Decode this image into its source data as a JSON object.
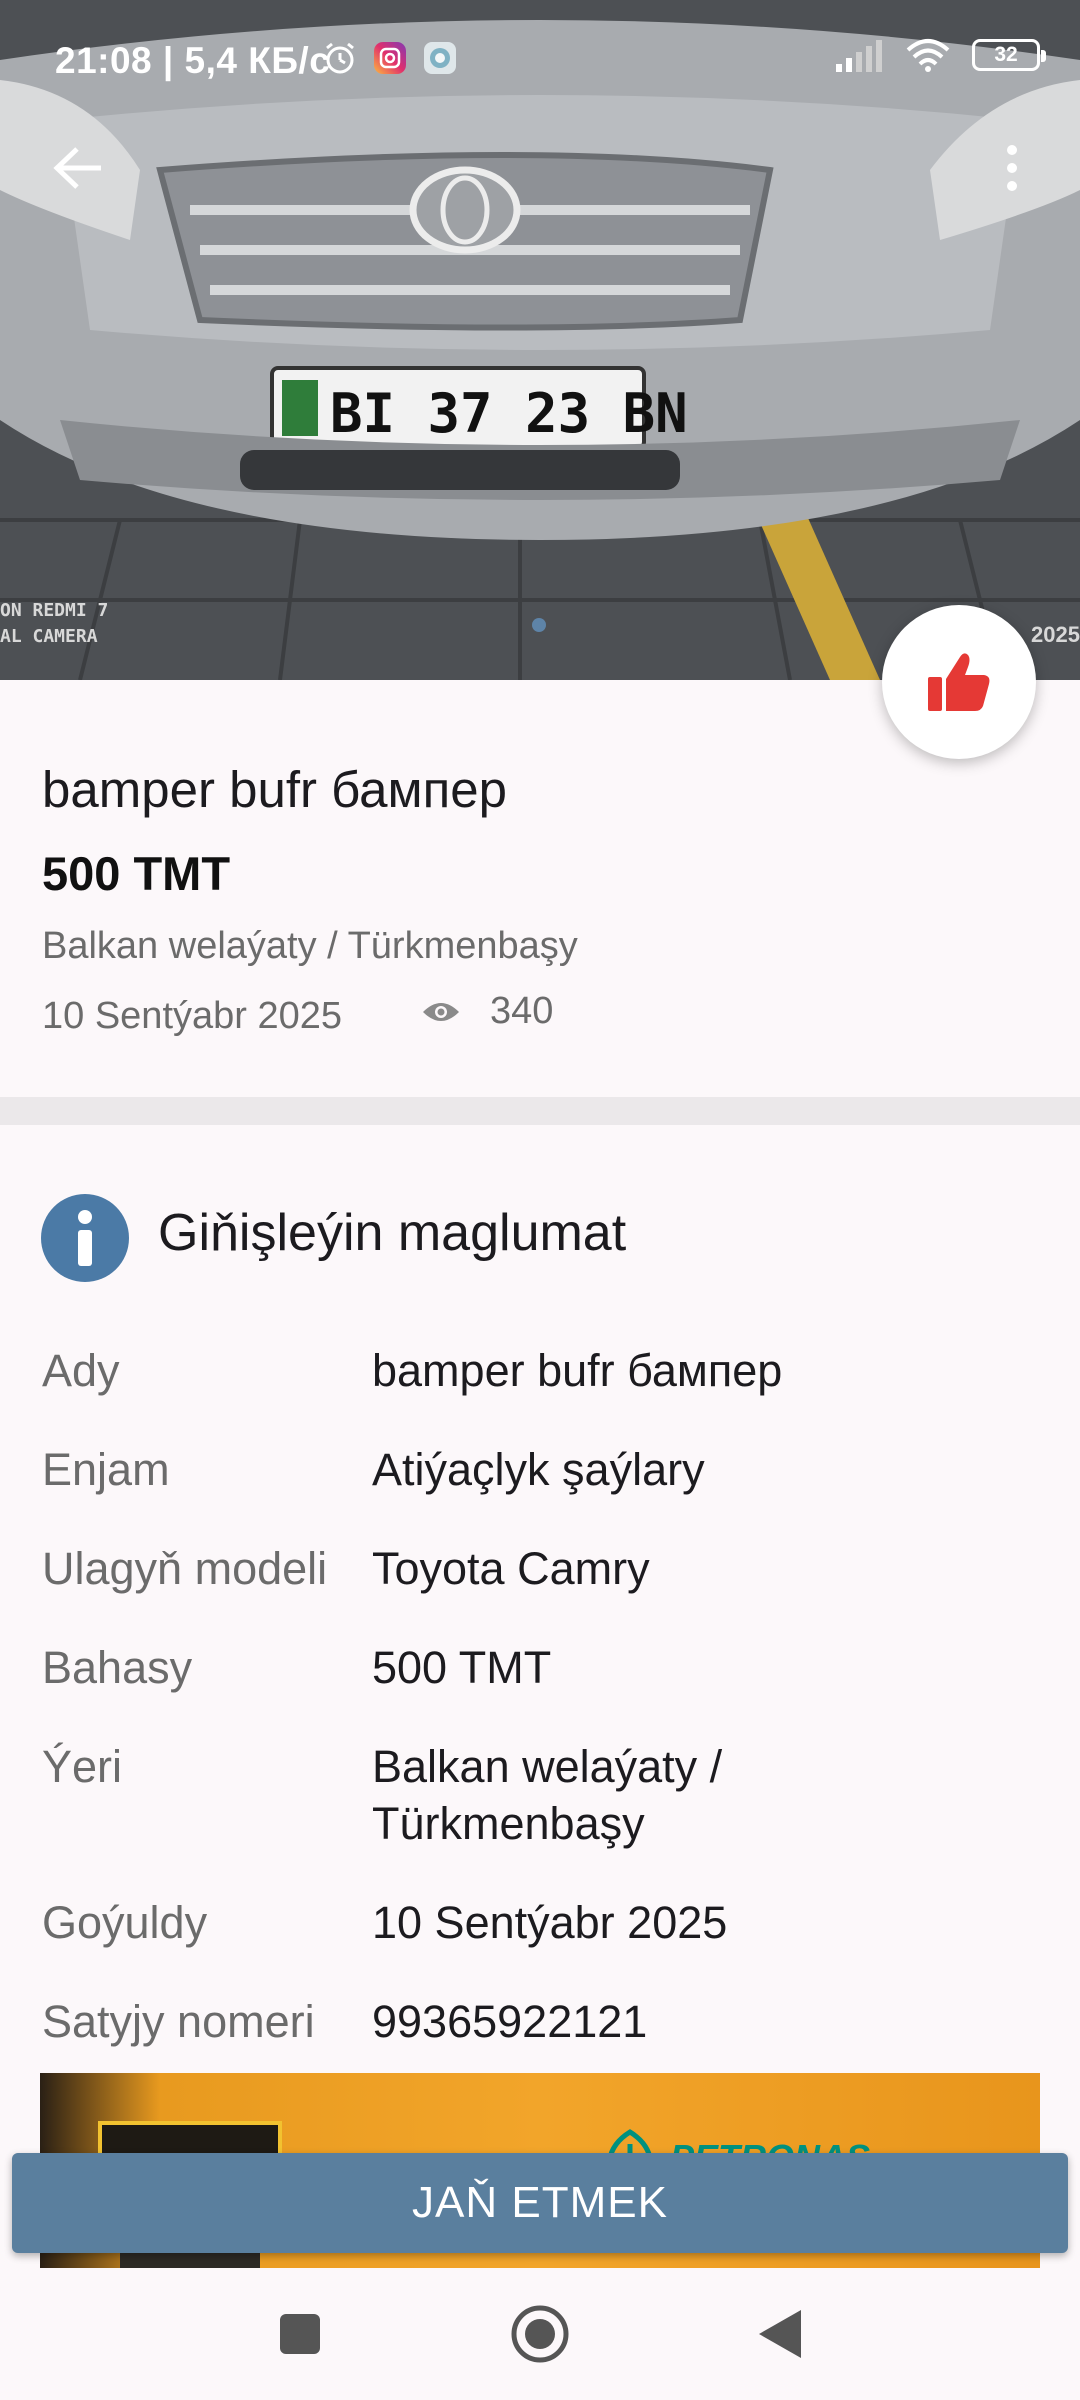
{
  "status_bar": {
    "time_speed": "21:08 | 5,4 КБ/с",
    "battery": "32"
  },
  "photo": {
    "plate": "BI 37 23 BN",
    "camera_watermark_1": "ON REDMI 7",
    "camera_watermark_2": "AL CAMERA",
    "year_watermark": "2025"
  },
  "listing": {
    "title": "bamper bufr бампер",
    "price": "500 TMT",
    "location": "Balkan welaýaty / Türkmenbaşy",
    "date": "10 Sentýabr 2025",
    "views": "340"
  },
  "details": {
    "section_title": "Giňişleýin maglumat",
    "rows": [
      {
        "key": "Ady",
        "value": "bamper bufr бампер"
      },
      {
        "key": "Enjam",
        "value": "Atiýaçlyk şaýlary"
      },
      {
        "key": "Ulagyň modeli",
        "value": "Toyota Camry"
      },
      {
        "key": "Bahasy",
        "value": "500 TMT"
      },
      {
        "key": "Ýeri",
        "value": "Balkan welaýaty /\nTürkmenbaşy"
      },
      {
        "key": "Goýuldy",
        "value": "10 Sentýabr 2025"
      },
      {
        "key": "Satyjy nomeri",
        "value": "99365922121"
      }
    ]
  },
  "banner": {
    "brand": "PETRONAS"
  },
  "cta": {
    "label": "JAŇ ETMEK"
  },
  "colors": {
    "accent": "#5a7f9e",
    "like": "#e53935",
    "info_icon": "#4b7aa6"
  }
}
